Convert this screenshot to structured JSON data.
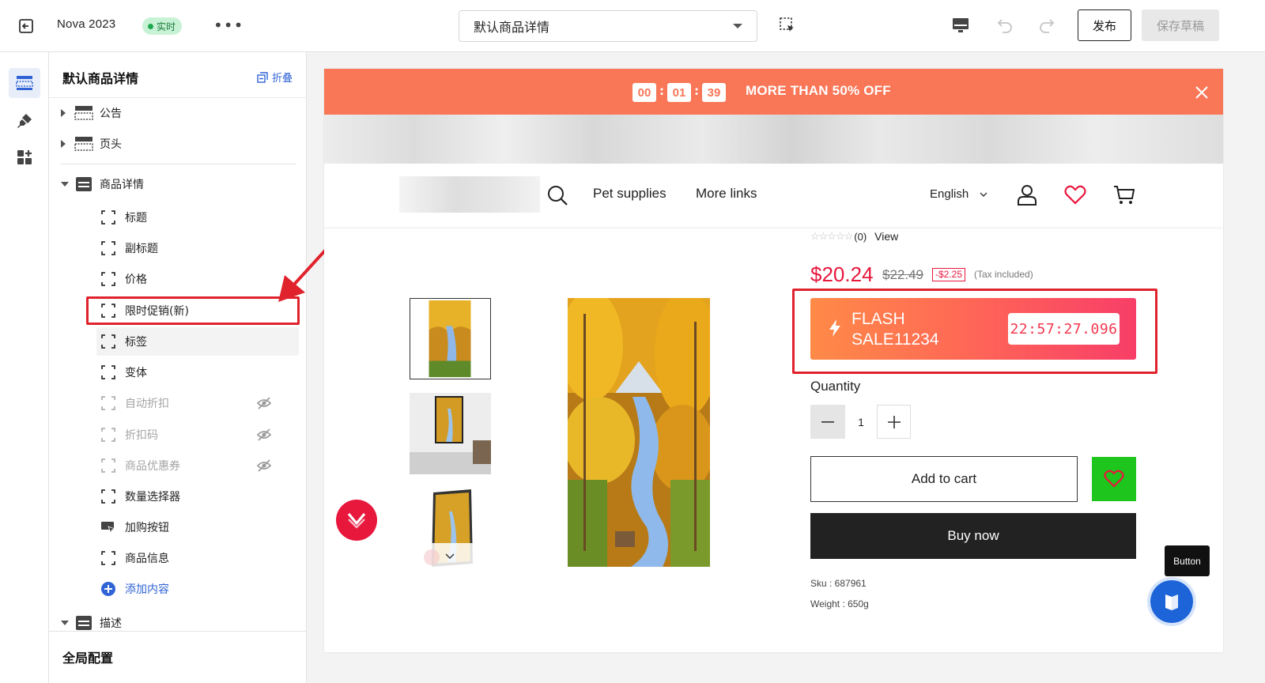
{
  "topbar": {
    "title": "Nova 2023",
    "live_badge": "实时",
    "more": "•••",
    "template_select": "默认商品详情",
    "publish": "发布",
    "save_draft": "保存草稿"
  },
  "panel": {
    "title": "默认商品详情",
    "collapse": "折叠",
    "sections": [
      {
        "label": "公告"
      },
      {
        "label": "页头"
      },
      {
        "label": "商品详情"
      },
      {
        "label": "描述"
      }
    ],
    "children": [
      {
        "label": "标题",
        "hidden": false
      },
      {
        "label": "副标题",
        "hidden": false
      },
      {
        "label": "价格",
        "hidden": false
      },
      {
        "label": "限时促销(新)",
        "hidden": false
      },
      {
        "label": "标签",
        "hidden": false
      },
      {
        "label": "变体",
        "hidden": false
      },
      {
        "label": "自动折扣",
        "hidden": true
      },
      {
        "label": "折扣码",
        "hidden": true
      },
      {
        "label": "商品优惠券",
        "hidden": true
      },
      {
        "label": "数量选择器",
        "hidden": false
      },
      {
        "label": "加购按钮",
        "hidden": false
      },
      {
        "label": "商品信息",
        "hidden": false
      }
    ],
    "add_content": "添加内容",
    "global_config": "全局配置"
  },
  "preview": {
    "promo": {
      "countdown": [
        "00",
        "01",
        "39"
      ],
      "text": "MORE THAN 50% OFF"
    },
    "nav": {
      "links": [
        "Pet supplies",
        "More links"
      ],
      "language": "English"
    },
    "product": {
      "rating_count": "(0)",
      "rating_view": "View",
      "price": "$20.24",
      "compare_price": "$22.49",
      "save": "-$2.25",
      "tax": "(Tax included)",
      "flash_title": "FLASH SALE11234",
      "flash_timer": "22:57:27.096",
      "quantity_label": "Quantity",
      "quantity": "1",
      "add_to_cart": "Add to cart",
      "buy_now": "Buy now",
      "sku": "Sku : 687961",
      "weight": "Weight : 650g"
    }
  },
  "tooltip": "Button",
  "colors": {
    "accent": "#2f63d6",
    "promo": "#f97657",
    "price": "#e8173c",
    "highlight": "#e0222c",
    "wishlist": "#1dc51d"
  }
}
